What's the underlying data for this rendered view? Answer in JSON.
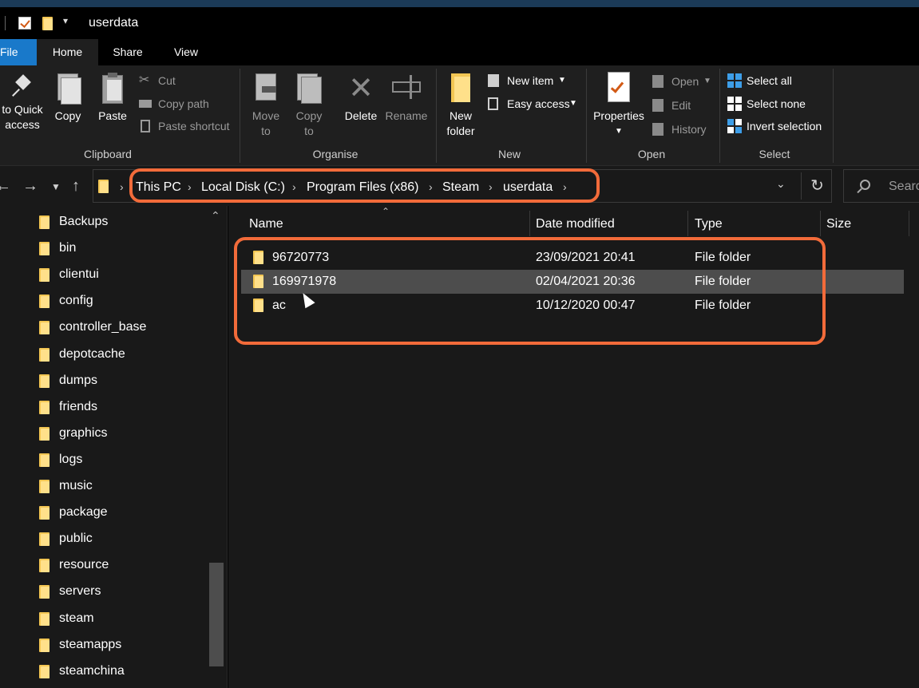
{
  "window": {
    "title": "userdata"
  },
  "tabs": {
    "file": "File",
    "home": "Home",
    "share": "Share",
    "view": "View"
  },
  "ribbon": {
    "clipboard": {
      "label": "Clipboard",
      "pin_line1": "to Quick",
      "pin_line2": "access",
      "copy": "Copy",
      "paste": "Paste",
      "cut": "Cut",
      "copy_path": "Copy path",
      "paste_shortcut": "Paste shortcut"
    },
    "organise": {
      "label": "Organise",
      "move_line1": "Move",
      "move_line2": "to",
      "copy_line1": "Copy",
      "copy_line2": "to",
      "delete": "Delete",
      "rename": "Rename"
    },
    "new": {
      "label": "New",
      "new_folder_line1": "New",
      "new_folder_line2": "folder",
      "new_item": "New item",
      "easy_access": "Easy access"
    },
    "open": {
      "label": "Open",
      "properties": "Properties",
      "open": "Open",
      "edit": "Edit",
      "history": "History"
    },
    "select": {
      "label": "Select",
      "select_all": "Select all",
      "select_none": "Select none",
      "invert": "Invert selection"
    }
  },
  "address": {
    "crumbs": [
      "This PC",
      "Local Disk (C:)",
      "Program Files (x86)",
      "Steam",
      "userdata"
    ],
    "search_placeholder": "Searc"
  },
  "columns": {
    "name": "Name",
    "date": "Date modified",
    "type": "Type",
    "size": "Size"
  },
  "files": [
    {
      "name": "96720773",
      "date": "23/09/2021 20:41",
      "type": "File folder",
      "selected": false
    },
    {
      "name": "169971978",
      "date": "02/04/2021 20:36",
      "type": "File folder",
      "selected": true
    },
    {
      "name": "ac",
      "date": "10/12/2020 00:47",
      "type": "File folder",
      "selected": false
    }
  ],
  "nav_items": [
    "Backups",
    "bin",
    "clientui",
    "config",
    "controller_base",
    "depotcache",
    "dumps",
    "friends",
    "graphics",
    "logs",
    "music",
    "package",
    "public",
    "resource",
    "servers",
    "steam",
    "steamapps",
    "steamchina"
  ],
  "colors": {
    "highlight": "#f26b3a",
    "file_tab": "#1979ca",
    "folder": "#f3c653"
  }
}
